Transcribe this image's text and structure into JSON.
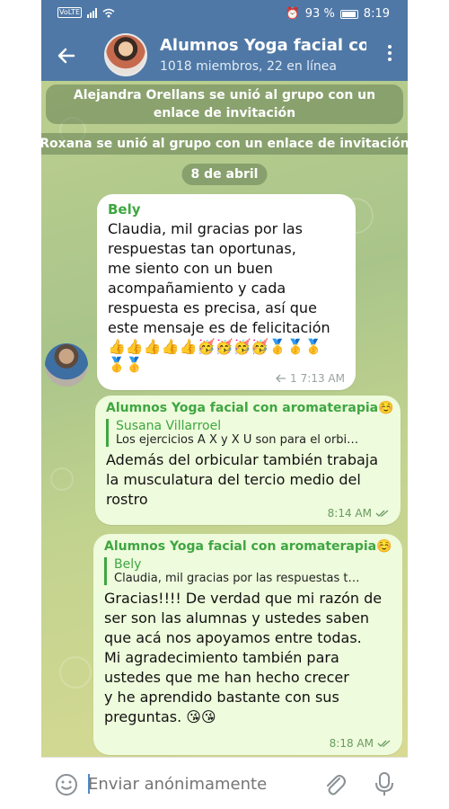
{
  "status_bar": {
    "network": "VoLTE",
    "battery": "93 %",
    "time": "8:19"
  },
  "header": {
    "title": "Alumnos Yoga facial con aromaterapia",
    "subtitle": "1018 miembros, 22 en línea"
  },
  "service_messages": [
    "Alejandra Orellans se unió al grupo con un enlace de invitación",
    "Roxana se unió al grupo con un enlace de invitación",
    "8 de abril"
  ],
  "messages": [
    {
      "sender": "Bely",
      "text": "Claudia, mil gracias por las\nrespuestas tan oportunas,\nme siento con un buen\nacompañamiento y cada\nrespuesta es precisa, así  que\neste mensaje es de felicitación",
      "emojis_line1": "👍👍👍👍👍🥳🥳🥳🥳🥇🥇🥇",
      "emojis_line2": "🥇🥇",
      "replies": "1",
      "time": "7:13 AM"
    },
    {
      "sender": "Alumnos Yoga facial con aromaterapia☺️",
      "reply_name": "Susana Villarroel",
      "reply_text": "Los ejercicios A X y X U son para el orbi…",
      "text": "Además del orbicular también trabaja\nla musculatura del tercio medio del\nrostro",
      "time": "8:14 AM"
    },
    {
      "sender": "Alumnos Yoga facial con aromaterapia☺️",
      "reply_name": "Bely",
      "reply_text": "Claudia, mil gracias por las respuestas t…",
      "text": "Gracias!!!!  De verdad que mi razón de\nser son las alumnas y ustedes saben\nque acá nos apoyamos entre todas.\nMi agradecimiento también para\nustedes que me han hecho crecer\ny he aprendido bastante con sus\npreguntas.  😘😘",
      "time": "8:18 AM"
    }
  ],
  "composer": {
    "placeholder": "Enviar anónimamente"
  },
  "colors": {
    "header": "#4f78a6",
    "sender": "#3fa642",
    "outgoing_bubble": "#eefbdc"
  },
  "icons": [
    "back-arrow-icon",
    "more-vert-icon",
    "emoji-icon",
    "paperclip-icon",
    "microphone-icon",
    "reply-icon",
    "double-check-icon"
  ]
}
